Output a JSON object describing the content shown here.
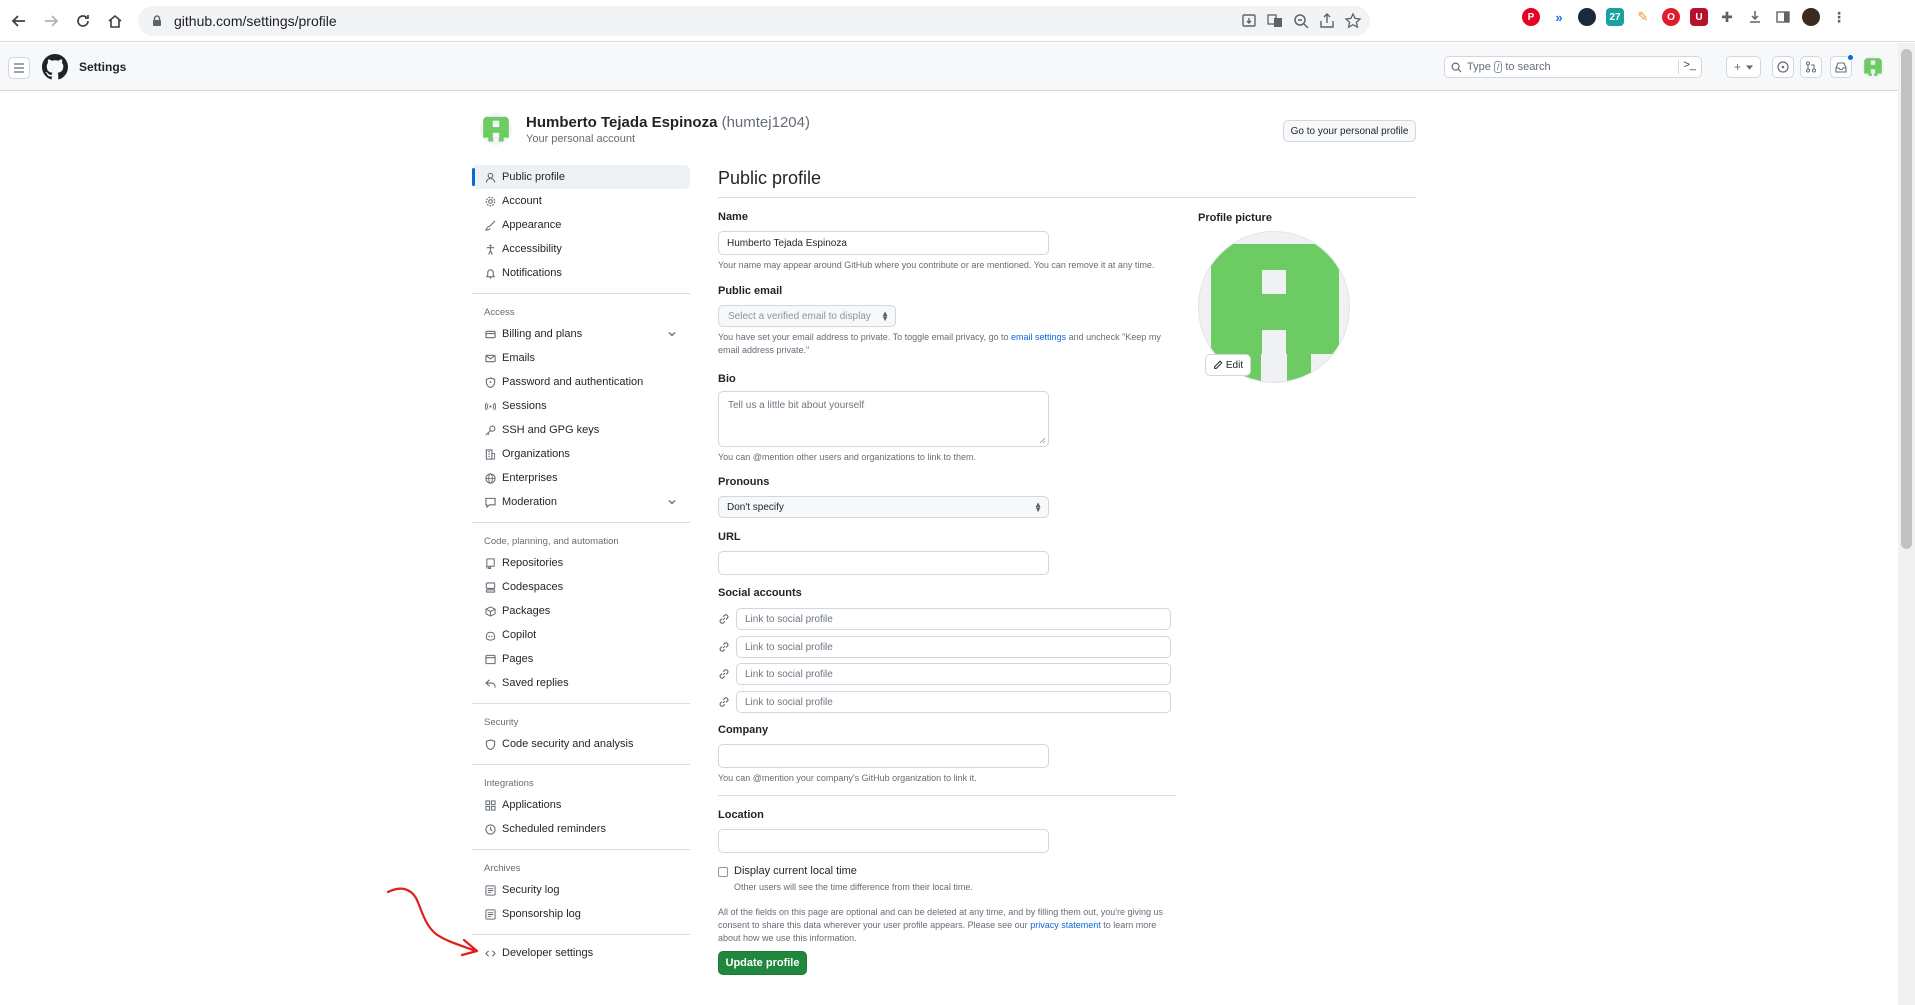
{
  "browser": {
    "url": "github.com/settings/profile"
  },
  "header": {
    "crumb": "Settings",
    "search_prefix": "Type",
    "search_key": "/",
    "search_suffix": "to search",
    "plus_label": "+",
    "prompt_glyph": ">_"
  },
  "user": {
    "name": "Humberto Tejada Espinoza",
    "login": "(humtej1204)",
    "sub": "Your personal account",
    "personal_button": "Go to your personal profile"
  },
  "sidebar": {
    "top": [
      {
        "label": "Public profile",
        "icon": "person-icon"
      },
      {
        "label": "Account",
        "icon": "gear-icon"
      },
      {
        "label": "Appearance",
        "icon": "paintbrush-icon"
      },
      {
        "label": "Accessibility",
        "icon": "accessibility-icon"
      },
      {
        "label": "Notifications",
        "icon": "bell-icon"
      }
    ],
    "access_head": "Access",
    "access": [
      {
        "label": "Billing and plans",
        "icon": "credit-card-icon"
      },
      {
        "label": "Emails",
        "icon": "mail-icon"
      },
      {
        "label": "Password and authentication",
        "icon": "shield-lock-icon"
      },
      {
        "label": "Sessions",
        "icon": "broadcast-icon"
      },
      {
        "label": "SSH and GPG keys",
        "icon": "key-icon"
      },
      {
        "label": "Organizations",
        "icon": "organization-icon"
      },
      {
        "label": "Enterprises",
        "icon": "globe-icon"
      },
      {
        "label": "Moderation",
        "icon": "report-icon"
      }
    ],
    "code_head": "Code, planning, and automation",
    "code": [
      {
        "label": "Repositories",
        "icon": "repo-icon"
      },
      {
        "label": "Codespaces",
        "icon": "codespaces-icon"
      },
      {
        "label": "Packages",
        "icon": "package-icon"
      },
      {
        "label": "Copilot",
        "icon": "copilot-icon"
      },
      {
        "label": "Pages",
        "icon": "browser-icon"
      },
      {
        "label": "Saved replies",
        "icon": "reply-icon"
      }
    ],
    "security_head": "Security",
    "security": [
      {
        "label": "Code security and analysis",
        "icon": "shield-icon"
      }
    ],
    "integrations_head": "Integrations",
    "integrations": [
      {
        "label": "Applications",
        "icon": "apps-icon"
      },
      {
        "label": "Scheduled reminders",
        "icon": "clock-icon"
      }
    ],
    "archives_head": "Archives",
    "archives": [
      {
        "label": "Security log",
        "icon": "log-icon"
      },
      {
        "label": "Sponsorship log",
        "icon": "log-icon"
      }
    ],
    "developer": {
      "label": "Developer settings",
      "icon": "code-icon"
    }
  },
  "main": {
    "title": "Public profile",
    "name_label": "Name",
    "name_value": "Humberto Tejada Espinoza",
    "name_note": "Your name may appear around GitHub where you contribute or are mentioned. You can remove it at any time.",
    "email_label": "Public email",
    "email_select": "Select a verified email to display",
    "email_note_1": "You have set your email address to private. To toggle email privacy, go to",
    "email_note_link": "email settings",
    "email_note_2": "and uncheck \"Keep my",
    "email_note_3": "email address private.\"",
    "bio_label": "Bio",
    "bio_placeholder": "Tell us a little bit about yourself",
    "bio_note": "You can @mention other users and organizations to link to them.",
    "pronouns_label": "Pronouns",
    "pronouns_value": "Don't specify",
    "url_label": "URL",
    "url_value": "",
    "social_label": "Social accounts",
    "social_placeholder": "Link to social profile",
    "company_label": "Company",
    "company_value": "",
    "company_note": "You can @mention your company's GitHub organization to link it.",
    "location_label": "Location",
    "location_value": "",
    "localtime_label": "Display current local time",
    "localtime_note": "Other users will see the time difference from their local time.",
    "footer_note_1": "All of the fields on this page are optional and can be deleted at any time, and by filling them out, you're giving us",
    "footer_note_2": "consent to share this data wherever your user profile appears. Please see our",
    "footer_note_link": "privacy statement",
    "footer_note_3": "to learn more",
    "footer_note_4": "about how we use this information.",
    "update_button": "Update profile"
  },
  "profile_picture": {
    "label": "Profile picture",
    "edit": "Edit"
  },
  "colors": {
    "accent": "#0969da",
    "primary_button": "#1f883d",
    "identicon": "#6dcb63",
    "annotation": "#e0201b"
  }
}
